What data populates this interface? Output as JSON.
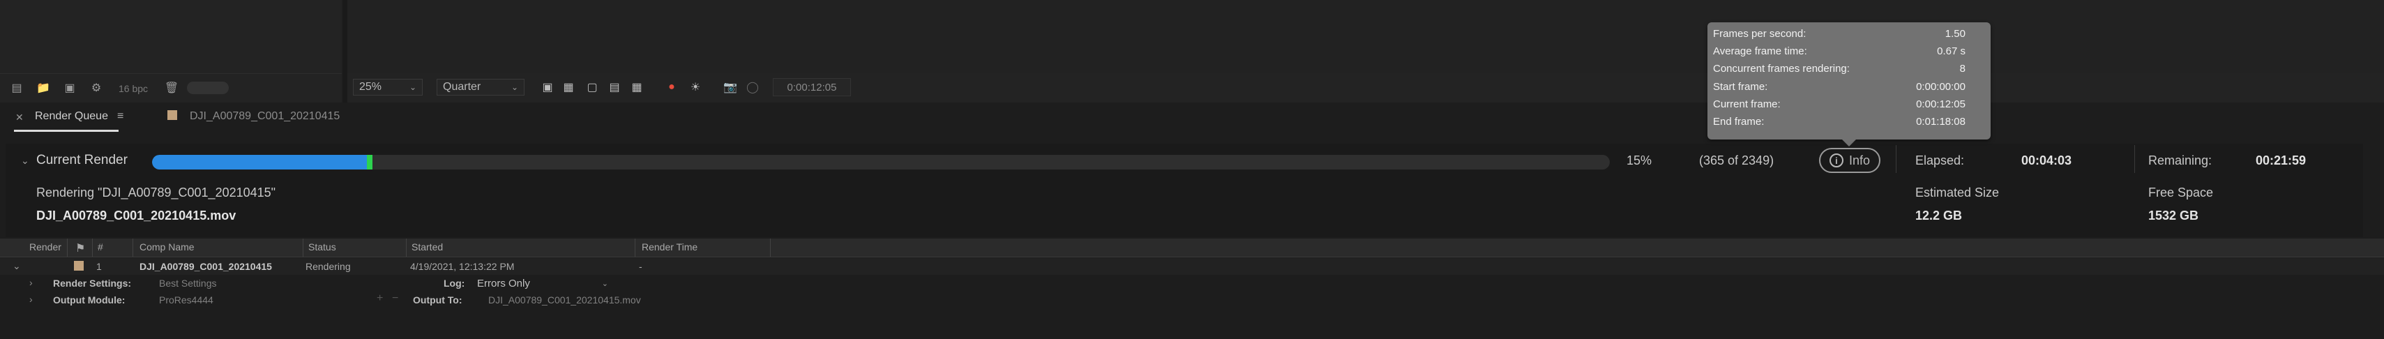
{
  "project_panel": {
    "bpc_label": "16 bpc"
  },
  "comp_viewer": {
    "zoom_value": "25%",
    "resolution_value": "Quarter",
    "timecode": "0:00:12:05"
  },
  "tabs": {
    "render_queue_label": "Render Queue",
    "comp_tab_label": "DJI_A00789_C001_20210415"
  },
  "current_render": {
    "title": "Current Render",
    "progress_fraction": 0.15,
    "percent_text": "15%",
    "frames_text": "(365 of 2349)",
    "info_label": "Info",
    "elapsed_label": "Elapsed:",
    "elapsed_value": "00:04:03",
    "remaining_label": "Remaining:",
    "remaining_value": "00:21:59",
    "rendering_text": "Rendering \"DJI_A00789_C001_20210415\"",
    "file_name": "DJI_A00789_C001_20210415.mov",
    "est_size_label": "Estimated Size",
    "est_size_value": "12.2 GB",
    "free_space_label": "Free Space",
    "free_space_value": "1532 GB"
  },
  "tooltip": [
    {
      "label": "Frames per second:",
      "value": "1.50"
    },
    {
      "label": "Average frame time:",
      "value": "0.67 s"
    },
    {
      "label": "Concurrent frames rendering:",
      "value": "8"
    },
    {
      "label": "Start frame:",
      "value": "0:00:00:00"
    },
    {
      "label": "Current frame:",
      "value": "0:00:12:05"
    },
    {
      "label": "End frame:",
      "value": "0:01:18:08"
    }
  ],
  "table": {
    "headers": {
      "render": "Render",
      "num": "#",
      "comp_name": "Comp Name",
      "status": "Status",
      "started": "Started",
      "render_time": "Render Time"
    },
    "row": {
      "num": "1",
      "comp_name": "DJI_A00789_C001_20210415",
      "status": "Rendering",
      "started": "4/19/2021, 12:13:22 PM",
      "render_time": "-"
    },
    "render_settings_label": "Render Settings:",
    "render_settings_value": "Best Settings",
    "log_label": "Log:",
    "log_value": "Errors Only",
    "output_module_label": "Output Module:",
    "output_module_value": "ProRes4444",
    "output_to_label": "Output To:",
    "output_to_value": "DJI_A00789_C001_20210415.mov"
  },
  "colors": {
    "progress": "#2a8ae2",
    "progress_edge": "#2dd34f",
    "label_swatch": "#c2a27d"
  }
}
